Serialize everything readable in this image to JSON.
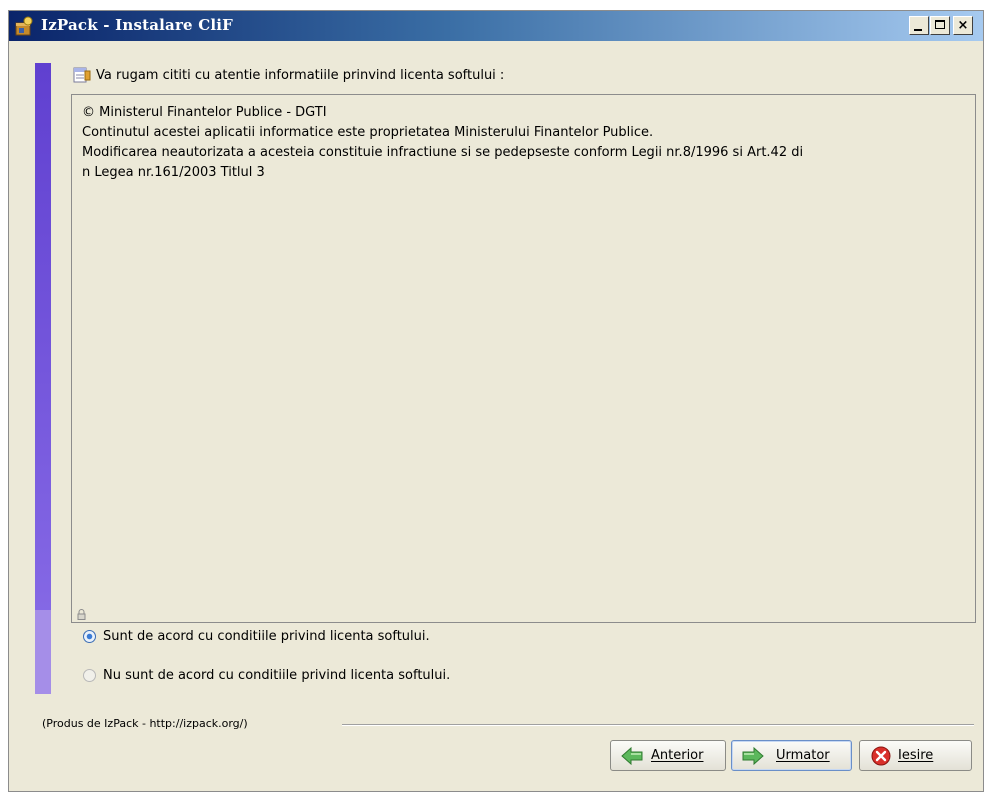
{
  "window": {
    "title": "IzPack - Instalare CliF"
  },
  "panel": {
    "header": "Va rugam cititi cu atentie informatiile prinvind licenta softului :",
    "license_lines": [
      "© Ministerul Finantelor Publice - DGTI",
      "Continutul acestei aplicatii informatice este proprietatea Ministerului Finantelor Publice.",
      "Modificarea neautorizata a acesteia constituie infractiune si se pedepseste conform Legii nr.8/1996 si Art.42 di",
      "n Legea nr.161/2003 Titlul 3"
    ],
    "options": [
      {
        "label": "Sunt de acord cu conditiile privind licenta softului.",
        "selected": true
      },
      {
        "label": "Nu sunt de acord cu conditiile privind licenta softului.",
        "selected": false
      }
    ]
  },
  "footer": {
    "credit": "(Produs de IzPack - http://izpack.org/)",
    "prev_label": "Anterior",
    "next_label": "Urmator",
    "exit_label": "Iesire"
  },
  "colors": {
    "titlebar": "#0a246a",
    "sidebar": "#6a4fd8",
    "window_bg": "#ece9d8",
    "radio_accent": "#3a7bd5"
  },
  "icons": {
    "app": "izpack-app-icon",
    "header": "license-document-icon",
    "prev": "arrow-left-icon",
    "next": "arrow-right-icon",
    "exit": "close-circle-icon"
  }
}
